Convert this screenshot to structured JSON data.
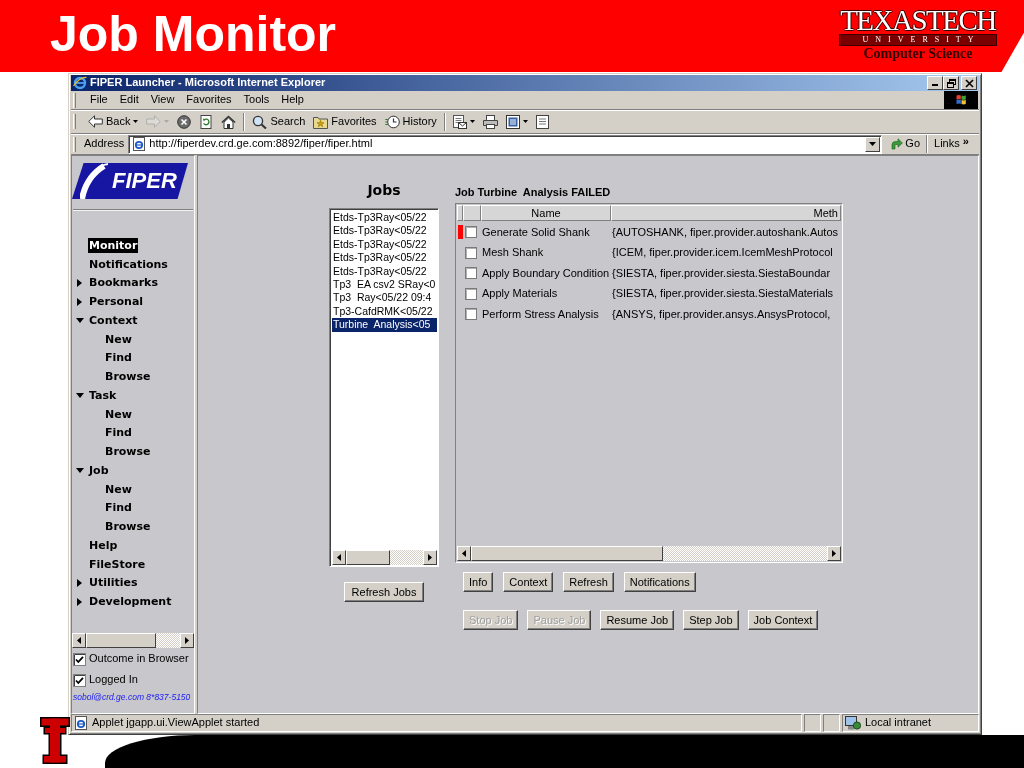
{
  "slide": {
    "title": "Job Monitor",
    "logo": {
      "wordmark": "TEXASTECH",
      "subtitle": "UNIVERSITY",
      "department": "Computer Science"
    }
  },
  "browser": {
    "title": "FIPER Launcher - Microsoft Internet Explorer",
    "menu": [
      "File",
      "Edit",
      "View",
      "Favorites",
      "Tools",
      "Help"
    ],
    "toolbar": [
      [
        {
          "kind": "back",
          "label": "Back",
          "disabled": false
        },
        {
          "kind": "forward",
          "disabled": true
        },
        {
          "kind": "stop",
          "disabled": false
        },
        {
          "kind": "refresh",
          "disabled": false
        },
        {
          "kind": "home",
          "disabled": false
        }
      ],
      [
        {
          "kind": "search",
          "label": "Search",
          "disabled": false
        },
        {
          "kind": "favorites",
          "label": "Favorites",
          "disabled": false
        },
        {
          "kind": "history",
          "label": "History",
          "disabled": false
        }
      ],
      [
        {
          "kind": "mail",
          "disabled": false
        },
        {
          "kind": "print",
          "disabled": false
        },
        {
          "kind": "edit",
          "disabled": false
        },
        {
          "kind": "discuss",
          "disabled": false
        }
      ]
    ],
    "address": {
      "label": "Address",
      "value": "http://fiperdev.crd.ge.com:8892/fiper/fiper.html",
      "go": "Go",
      "links": "Links",
      "more": "»"
    },
    "status_bar": {
      "text": "Applet jgapp.ui.ViewApplet started",
      "zone": "Local intranet"
    }
  },
  "sidebar": {
    "logo": "FIPER",
    "items": [
      {
        "label": "Monitor",
        "selected": true
      },
      {
        "label": "Notifications",
        "selected": false
      },
      {
        "label": "Bookmarks",
        "selected": false,
        "expanded": false
      },
      {
        "label": "Personal",
        "selected": false,
        "expanded": false
      },
      {
        "label": "Context",
        "selected": false,
        "expanded": true,
        "children": [
          {
            "label": "New",
            "selected": false
          },
          {
            "label": "Find",
            "selected": false
          },
          {
            "label": "Browse",
            "selected": false
          }
        ]
      },
      {
        "label": "Task",
        "selected": false,
        "expanded": true,
        "children": [
          {
            "label": "New",
            "selected": false
          },
          {
            "label": "Find",
            "selected": false
          },
          {
            "label": "Browse",
            "selected": false
          }
        ]
      },
      {
        "label": "Job",
        "selected": false,
        "expanded": true,
        "children": [
          {
            "label": "New",
            "selected": false
          },
          {
            "label": "Find",
            "selected": false
          },
          {
            "label": "Browse",
            "selected": false
          }
        ]
      },
      {
        "label": "Help",
        "selected": false
      },
      {
        "label": "FileStore",
        "selected": false
      },
      {
        "label": "Utilities",
        "selected": false,
        "expanded": false
      },
      {
        "label": "Development",
        "selected": false,
        "expanded": false
      }
    ],
    "options": [
      {
        "label": "Outcome in Browser",
        "checked": true
      },
      {
        "label": "Logged In",
        "checked": true
      }
    ],
    "contact": "sobol@crd.ge.com 8*837-5150"
  },
  "jobs": {
    "title": "Jobs",
    "items": [
      {
        "label": "Etds-Tp3Ray<05/22",
        "selected": false
      },
      {
        "label": "Etds-Tp3Ray<05/22",
        "selected": false
      },
      {
        "label": "Etds-Tp3Ray<05/22",
        "selected": false
      },
      {
        "label": "Etds-Tp3Ray<05/22",
        "selected": false
      },
      {
        "label": "Etds-Tp3Ray<05/22",
        "selected": false
      },
      {
        "label": "Tp3  EA csv2 SRay<0",
        "selected": false
      },
      {
        "label": "Tp3  Ray<05/22 09:4",
        "selected": false
      },
      {
        "label": "Tp3-CafdRMK<05/22",
        "selected": false
      },
      {
        "label": "Turbine  Analysis<05",
        "selected": true
      }
    ],
    "button": "Refresh Jobs"
  },
  "job": {
    "title": "Job Turbine  Analysis FAILED",
    "columns": [
      "Name",
      "Meth"
    ],
    "rows": [
      {
        "failed": true,
        "checked": false,
        "name": "Generate Solid Shank",
        "method": "{AUTOSHANK, fiper.provider.autoshank.Autos"
      },
      {
        "failed": false,
        "checked": false,
        "name": "Mesh Shank",
        "method": "{ICEM, fiper.provider.icem.IcemMeshProtocol"
      },
      {
        "failed": false,
        "checked": false,
        "name": "Apply Boundary Condition",
        "method": "{SIESTA, fiper.provider.siesta.SiestaBoundar"
      },
      {
        "failed": false,
        "checked": false,
        "name": "Apply Materials",
        "method": "{SIESTA, fiper.provider.siesta.SiestaMaterials"
      },
      {
        "failed": false,
        "checked": false,
        "name": "Perform Stress Analysis",
        "method": "{ANSYS, fiper.provider.ansys.AnsysProtocol,"
      }
    ],
    "actions": [
      {
        "label": "Info",
        "disabled": false
      },
      {
        "label": "Context",
        "disabled": false
      },
      {
        "label": "Refresh",
        "disabled": false
      },
      {
        "label": "Notifications",
        "disabled": false
      }
    ],
    "controls": [
      {
        "label": "Stop Job",
        "disabled": true
      },
      {
        "label": "Pause Job",
        "disabled": true
      },
      {
        "label": "Resume Job",
        "disabled": false
      },
      {
        "label": "Step Job",
        "disabled": false
      },
      {
        "label": "Job Context",
        "disabled": false
      }
    ]
  }
}
